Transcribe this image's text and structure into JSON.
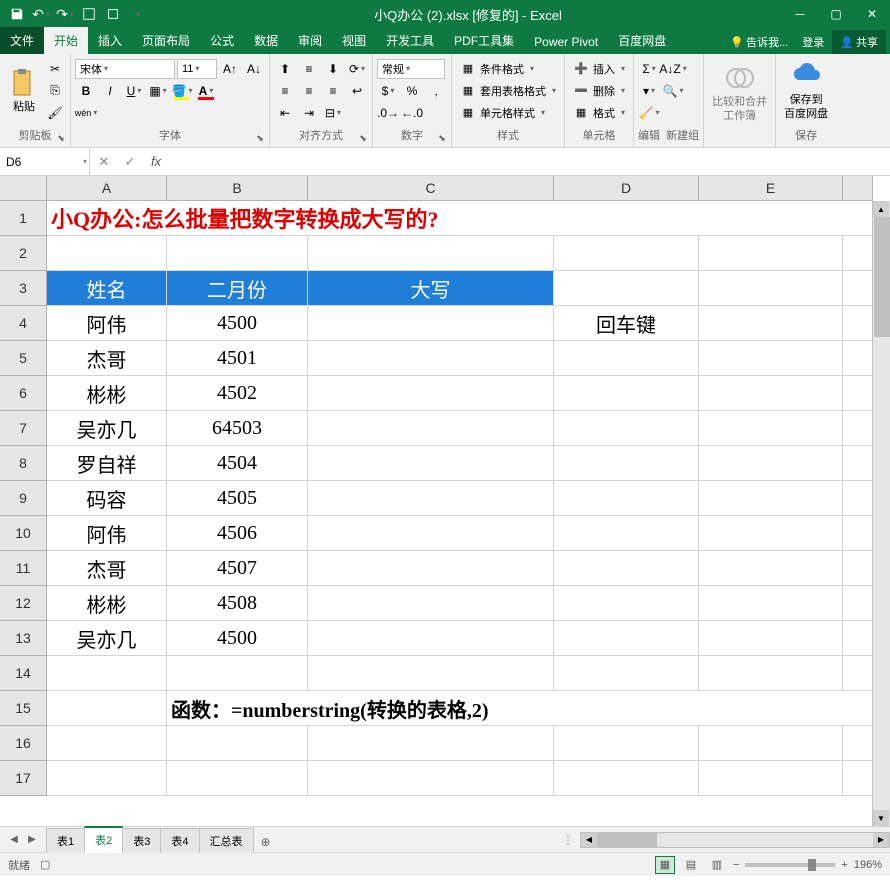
{
  "title": "小Q办公 (2).xlsx [修复的] - Excel",
  "qat": {
    "save": "💾",
    "undo": "↶",
    "redo": "↷"
  },
  "tabs": {
    "file": "文件",
    "items": [
      "开始",
      "插入",
      "页面布局",
      "公式",
      "数据",
      "审阅",
      "视图",
      "开发工具",
      "PDF工具集",
      "Power Pivot",
      "百度网盘"
    ],
    "active": 0,
    "tellme": "告诉我...",
    "signin": "登录",
    "share": "共享"
  },
  "ribbon": {
    "clipboard": {
      "paste": "粘贴",
      "label": "剪贴板"
    },
    "font": {
      "name": "宋体",
      "size": "11",
      "label": "字体"
    },
    "align": {
      "label": "对齐方式"
    },
    "number": {
      "format": "常规",
      "label": "数字"
    },
    "styles": {
      "cond": "条件格式",
      "table": "套用表格格式",
      "cell": "单元格样式",
      "label": "样式"
    },
    "cells": {
      "insert": "插入",
      "delete": "删除",
      "format": "格式",
      "label": "单元格"
    },
    "editing": {
      "label": "编辑",
      "newgroup": "新建组"
    },
    "compare": {
      "line1": "比较和合并",
      "line2": "工作簿"
    },
    "baidu": {
      "line1": "保存到",
      "line2": "百度网盘",
      "label": "保存"
    }
  },
  "formula": {
    "name_box": "D6",
    "fx": "fx",
    "value": ""
  },
  "columns": [
    "A",
    "B",
    "C",
    "D",
    "E"
  ],
  "cells": {
    "r1": {
      "title": "小Q办公:怎么批量把数字转换成大写的?"
    },
    "r3": {
      "A": "姓名",
      "B": "二月份",
      "C": "大写"
    },
    "r4": {
      "A": "阿伟",
      "B": "4500",
      "D": "回车键"
    },
    "r5": {
      "A": "杰哥",
      "B": "4501"
    },
    "r6": {
      "A": "彬彬",
      "B": "4502"
    },
    "r7": {
      "A": "吴亦几",
      "B": "64503"
    },
    "r8": {
      "A": "罗自祥",
      "B": "4504"
    },
    "r9": {
      "A": "码容",
      "B": "4505"
    },
    "r10": {
      "A": "阿伟",
      "B": "4506"
    },
    "r11": {
      "A": "杰哥",
      "B": "4507"
    },
    "r12": {
      "A": "彬彬",
      "B": "4508"
    },
    "r13": {
      "A": "吴亦几",
      "B": "4500"
    },
    "r15": {
      "text": "函数：=numberstring(转换的表格,2)"
    }
  },
  "sheets": {
    "items": [
      "表1",
      "表2",
      "表3",
      "表4",
      "汇总表"
    ],
    "active": 1
  },
  "status": {
    "ready": "就绪",
    "zoom": "196%"
  }
}
